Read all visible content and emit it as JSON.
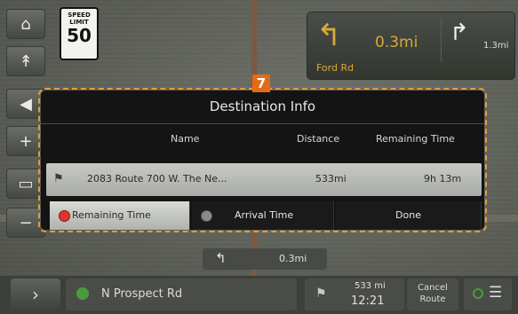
{
  "speed_limit": {
    "label_line1": "SPEED",
    "label_line2": "LIMIT",
    "value": "50"
  },
  "side_buttons": [
    {
      "icon": "home-icon",
      "glyph": "⌂"
    },
    {
      "icon": "compass-icon",
      "glyph": "↟"
    },
    {
      "icon": "volume-icon",
      "glyph": "◀"
    },
    {
      "icon": "zoom-in-icon",
      "glyph": "+"
    },
    {
      "icon": "map-view-icon",
      "glyph": "▭"
    },
    {
      "icon": "zoom-out-icon",
      "glyph": "−"
    }
  ],
  "turn_panel": {
    "primary_arrow": "↰",
    "primary_distance": "0.3mi",
    "road": "Ford Rd",
    "secondary_arrow": "↱",
    "secondary_distance": "1.3mi"
  },
  "callout_number": "7",
  "dialog": {
    "title": "Destination Info",
    "columns": {
      "name": "Name",
      "distance": "Distance",
      "remaining": "Remaining Time"
    },
    "row": {
      "address": "2083 Route 700 W. The Ne...",
      "distance": "533mi",
      "remaining": "9h 13m"
    },
    "options": {
      "remaining_time": "Remaining Time",
      "arrival_time": "Arrival Time",
      "done": "Done"
    },
    "selected_option": "remaining_time"
  },
  "next_turn": {
    "arrow": "↰",
    "distance": "0.3mi"
  },
  "bottom_bar": {
    "street": "N Prospect Rd",
    "eta_distance": "533 mi",
    "eta_time": "12:21",
    "cancel_line1": "Cancel",
    "cancel_line2": "Route",
    "menu_glyph": "☰"
  },
  "colors": {
    "accent_orange": "#e56a18",
    "turn_amber": "#d7a83a",
    "radio_active": "#e0332b",
    "gps_green": "#4c9a3e"
  }
}
